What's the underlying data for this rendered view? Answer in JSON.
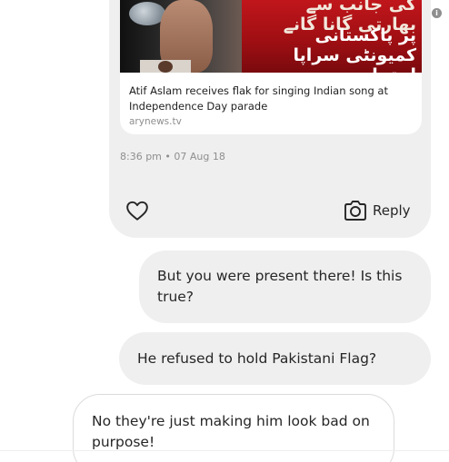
{
  "header": {
    "info_icon": "i"
  },
  "shared_post": {
    "image": {
      "caption_line1": "کی جانب سے بھارتی گانا گانے",
      "caption_line2": "پر پاکستانی کمیونٹی سراپا احتجاج"
    },
    "title": "Atif Aslam receives flak for singing Indian song at Independence Day parade",
    "source": "arynews.tv",
    "timestamp": "8:36 pm • 07 Aug 18",
    "like_icon": "heart-icon",
    "reply_icon": "camera-icon",
    "reply_label": "Reply"
  },
  "messages": [
    {
      "text": "But you were present there! Is this true?",
      "side": "right",
      "style": "gray"
    },
    {
      "text": "He refused to hold Pakistani Flag?",
      "side": "right",
      "style": "gray"
    },
    {
      "text": "No they're just making him look bad on purpose!",
      "side": "left",
      "style": "white"
    }
  ],
  "colors": {
    "bubble_gray": "#efefef",
    "bubble_border": "#dbdbdb",
    "meta_gray": "#8e8e8e",
    "text": "#262626"
  }
}
